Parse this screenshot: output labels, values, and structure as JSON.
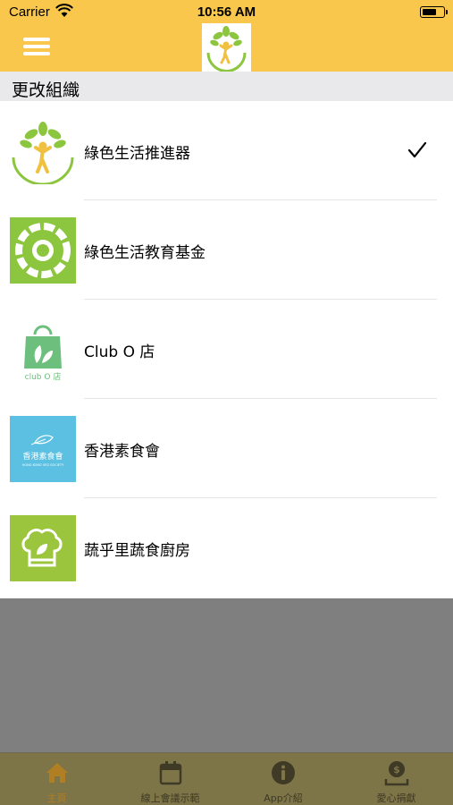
{
  "status_bar": {
    "carrier": "Carrier",
    "time": "10:56 AM"
  },
  "nav": {
    "menu_icon": "hamburger-menu-icon",
    "logo_icon": "tree-person-logo-icon",
    "color": "#f8c74c"
  },
  "section": {
    "title": "更改組織"
  },
  "organizations": [
    {
      "name": "綠色生活推進器",
      "logo": "tree-person-logo",
      "selected": true
    },
    {
      "name": "綠色生活教育基金",
      "logo": "green-ring-logo",
      "selected": false
    },
    {
      "name": "Club O 店",
      "logo": "shopping-bag-logo",
      "selected": false
    },
    {
      "name": "香港素食會",
      "logo": "vegetarian-society-logo",
      "selected": false
    },
    {
      "name": "蔬乎里蔬食廚房",
      "logo": "chef-hat-leaf-logo",
      "selected": false
    }
  ],
  "tabs": [
    {
      "label": "主頁",
      "icon": "home-icon",
      "active": true
    },
    {
      "label": "線上會議示範",
      "icon": "calendar-icon",
      "active": false
    },
    {
      "label": "App介紹",
      "icon": "info-icon",
      "active": false
    },
    {
      "label": "愛心捐獻",
      "icon": "donate-icon",
      "active": false
    }
  ],
  "colors": {
    "header": "#f8c74c",
    "brand_green": "#8cc63f",
    "overlay": "#7f7f7f",
    "active_tab": "#b07f24"
  }
}
